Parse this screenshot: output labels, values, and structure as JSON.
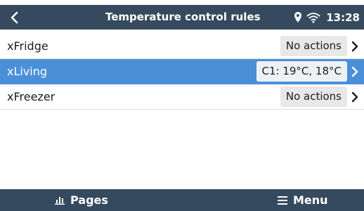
{
  "header": {
    "title": "Temperature control rules",
    "time": "13:28",
    "back_icon": "chevron-left-icon",
    "location_icon": "location-pin-icon",
    "wifi_icon": "wifi-icon"
  },
  "rules": [
    {
      "label": "xFridge",
      "value": "No actions",
      "selected": false
    },
    {
      "label": "xLiving",
      "value": "C1: 19°C, 18°C",
      "selected": true
    },
    {
      "label": "xFreezer",
      "value": "No actions",
      "selected": false
    }
  ],
  "footer": {
    "pages_label": "Pages",
    "pages_icon": "bar-chart-icon",
    "menu_label": "Menu",
    "menu_icon": "hamburger-menu-icon"
  },
  "colors": {
    "header_bg": "#364a5f",
    "selected_row_bg": "#4a90d9",
    "value_badge_bg": "#e8e8e8"
  }
}
